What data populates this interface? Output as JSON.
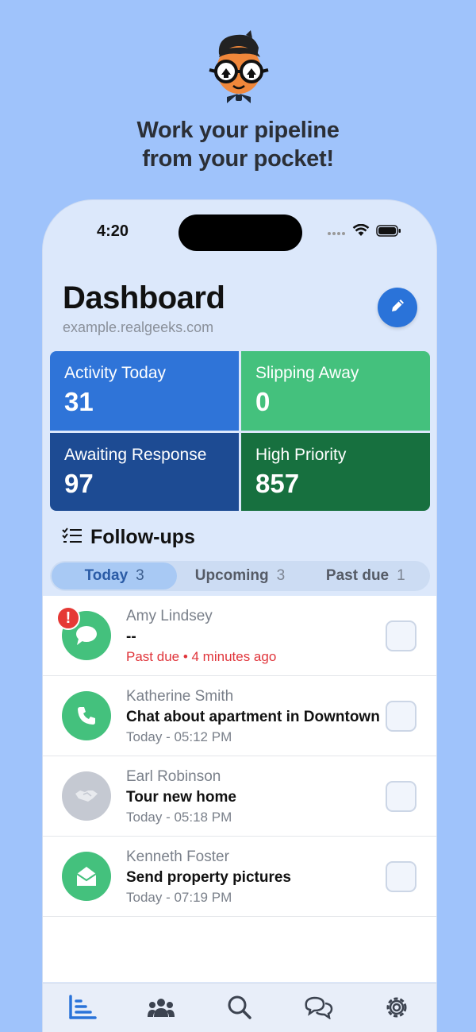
{
  "promo": {
    "tagline_line1": "Work your pipeline",
    "tagline_line2": "from your pocket!"
  },
  "status_bar": {
    "time": "4:20"
  },
  "header": {
    "title": "Dashboard",
    "subtitle": "example.realgeeks.com",
    "edit_icon": "pencil-icon"
  },
  "stats": [
    {
      "label": "Activity Today",
      "value": "31",
      "color": "#2f74d8"
    },
    {
      "label": "Slipping Away",
      "value": "0",
      "color": "#44c17d"
    },
    {
      "label": "Awaiting Response",
      "value": "97",
      "color": "#1d4b93"
    },
    {
      "label": "High Priority",
      "value": "857",
      "color": "#17703f"
    }
  ],
  "followups": {
    "title": "Follow-ups",
    "tabs": [
      {
        "label": "Today",
        "count": "3",
        "active": true
      },
      {
        "label": "Upcoming",
        "count": "3",
        "active": false
      },
      {
        "label": "Past due",
        "count": "1",
        "active": false
      }
    ],
    "items": [
      {
        "name": "Amy Lindsey",
        "subject": "--",
        "time": "Past due • 4 minutes ago",
        "icon": "chat-bubble-icon",
        "icon_color": "#44c17d",
        "overdue": true,
        "alert": "!"
      },
      {
        "name": "Katherine Smith",
        "subject": "Chat about apartment in Downtown",
        "time": "Today - 05:12 PM",
        "icon": "phone-icon",
        "icon_color": "#44c17d",
        "overdue": false
      },
      {
        "name": "Earl Robinson",
        "subject": "Tour new home",
        "time": "Today - 05:18 PM",
        "icon": "handshake-icon",
        "icon_color": "#c5c9d2",
        "overdue": false
      },
      {
        "name": "Kenneth Foster",
        "subject": "Send property pictures",
        "time": "Today - 07:19 PM",
        "icon": "open-envelope-icon",
        "icon_color": "#44c17d",
        "overdue": false
      }
    ]
  },
  "tab_bar": [
    {
      "icon": "bar-chart-icon",
      "active": true
    },
    {
      "icon": "people-icon",
      "active": false
    },
    {
      "icon": "search-icon",
      "active": false
    },
    {
      "icon": "chat-bubbles-icon",
      "active": false
    },
    {
      "icon": "gear-icon",
      "active": false
    }
  ],
  "colors": {
    "background": "#9fc3fb",
    "phone_background": "#dce8fb",
    "accent": "#2a73d9",
    "overdue": "#e0353b"
  }
}
